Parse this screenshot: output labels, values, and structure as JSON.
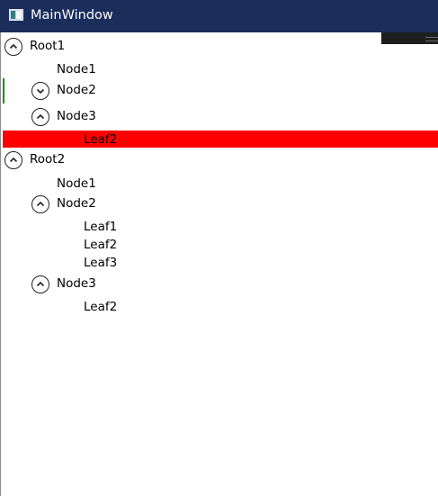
{
  "window": {
    "title": "MainWindow",
    "icon": "window-icon"
  },
  "tree": {
    "root1": {
      "label": "Root1",
      "node1": "Node1",
      "node2": "Node2",
      "node3": "Node3",
      "node3_leaf": "Leaf2"
    },
    "root2": {
      "label": "Root2",
      "node1": "Node1",
      "node2": "Node2",
      "node2_leaves": [
        "Leaf1",
        "Leaf2",
        "Leaf3"
      ],
      "node3": "Node3",
      "node3_leaf": "Leaf2"
    }
  },
  "colors": {
    "titlebar": "#1b2d5b",
    "selected_row": "#ff0000",
    "focus_marker": "#1f8a1f"
  }
}
